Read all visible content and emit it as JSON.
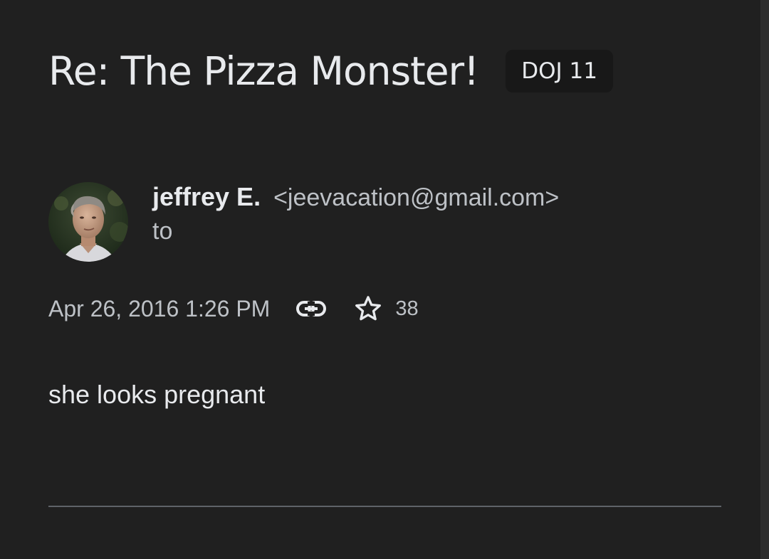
{
  "email": {
    "subject": "Re: The Pizza Monster!",
    "label": "DOJ 11",
    "sender": {
      "name": "jeffrey E.",
      "email": "<jeevacation@gmail.com>"
    },
    "recipient_line": "to",
    "date": "Apr 26, 2016 1:26 PM",
    "star_count": "38",
    "body": "she looks pregnant"
  },
  "icons": {
    "link": "link-icon",
    "star": "star-outline-icon"
  },
  "colors": {
    "background": "#202020",
    "primary_text": "#e8eaed",
    "secondary_text": "#bdc1c6",
    "chip_background": "#181818",
    "divider": "#5f6368"
  }
}
